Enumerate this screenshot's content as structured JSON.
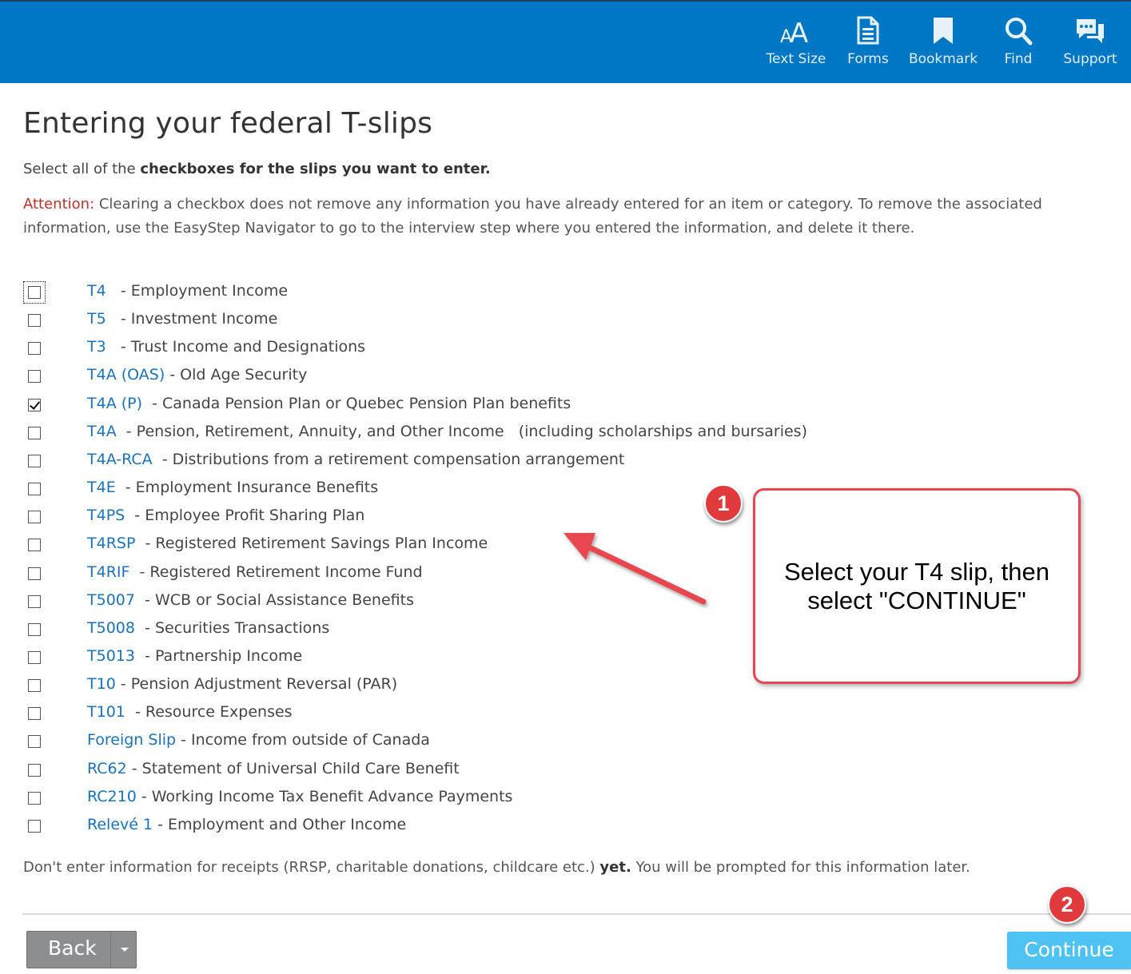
{
  "toolbar": {
    "items": [
      {
        "label": "Text Size",
        "icon": "text-size-icon"
      },
      {
        "label": "Forms",
        "icon": "forms-icon"
      },
      {
        "label": "Bookmark",
        "icon": "bookmark-icon"
      },
      {
        "label": "Find",
        "icon": "search-icon"
      },
      {
        "label": "Support",
        "icon": "chat-bubbles-icon"
      }
    ]
  },
  "page": {
    "title": "Entering your federal T-slips",
    "intro_prefix": "Select all of the ",
    "intro_bold": "checkboxes for the slips you want to enter.",
    "attention_label": "Attention:",
    "attention_text": " Clearing a checkbox does not remove any information you have already entered for an item or category. To remove the associated information, use the EasyStep Navigator to go to the interview step where you entered the information, and delete it there.",
    "footnote_prefix": "Don't enter information for receipts (RRSP, charitable donations, childcare etc.) ",
    "footnote_bold": "yet.",
    "footnote_suffix": " You will be prompted for this information later."
  },
  "slips": [
    {
      "code": "T4",
      "desc": "   - Employment Income",
      "checked": false
    },
    {
      "code": "T5",
      "desc": "   - Investment Income",
      "checked": false
    },
    {
      "code": "T3",
      "desc": "   - Trust Income and Designations",
      "checked": false
    },
    {
      "code": "T4A (OAS)",
      "desc": " - Old Age Security",
      "checked": false
    },
    {
      "code": "T4A (P)",
      "desc": "  - Canada Pension Plan or Quebec Pension Plan benefits",
      "checked": true
    },
    {
      "code": "T4A",
      "desc": "  - Pension, Retirement, Annuity, and Other Income   (including scholarships and bursaries)",
      "checked": false
    },
    {
      "code": "T4A-RCA",
      "desc": "  - Distributions from a retirement compensation arrangement",
      "checked": false
    },
    {
      "code": "T4E",
      "desc": "  - Employment Insurance Benefits",
      "checked": false
    },
    {
      "code": "T4PS",
      "desc": "  - Employee Profit Sharing Plan",
      "checked": false
    },
    {
      "code": "T4RSP",
      "desc": "  - Registered Retirement Savings Plan Income",
      "checked": false
    },
    {
      "code": "T4RIF",
      "desc": "  - Registered Retirement Income Fund",
      "checked": false
    },
    {
      "code": "T5007",
      "desc": "  - WCB or Social Assistance Benefits",
      "checked": false
    },
    {
      "code": "T5008",
      "desc": "  - Securities Transactions",
      "checked": false
    },
    {
      "code": "T5013",
      "desc": "  - Partnership Income",
      "checked": false
    },
    {
      "code": "T10",
      "desc": " - Pension Adjustment Reversal (PAR)",
      "checked": false
    },
    {
      "code": "T101",
      "desc": "  - Resource Expenses",
      "checked": false
    },
    {
      "code": "Foreign Slip",
      "desc": " - Income from outside of Canada",
      "checked": false
    },
    {
      "code": "RC62",
      "desc": " - Statement of Universal Child Care Benefit",
      "checked": false
    },
    {
      "code": "RC210",
      "desc": " - Working Income Tax Benefit Advance Payments",
      "checked": false
    },
    {
      "code": "Relevé 1",
      "desc": " - Employment and Other Income",
      "checked": false
    }
  ],
  "buttons": {
    "back_label": "Back",
    "continue_label": "Continue"
  },
  "annotations": {
    "badge1": "1",
    "badge2": "2",
    "callout_text": "Select your T4 slip, then select \"CONTINUE\""
  },
  "colors": {
    "header_bg": "#0077c5",
    "link": "#1a72bb",
    "attention": "#b8322c",
    "continue_bg": "#4ec3f3",
    "back_bg": "#8c8e90",
    "callout_red": "#e84650"
  }
}
